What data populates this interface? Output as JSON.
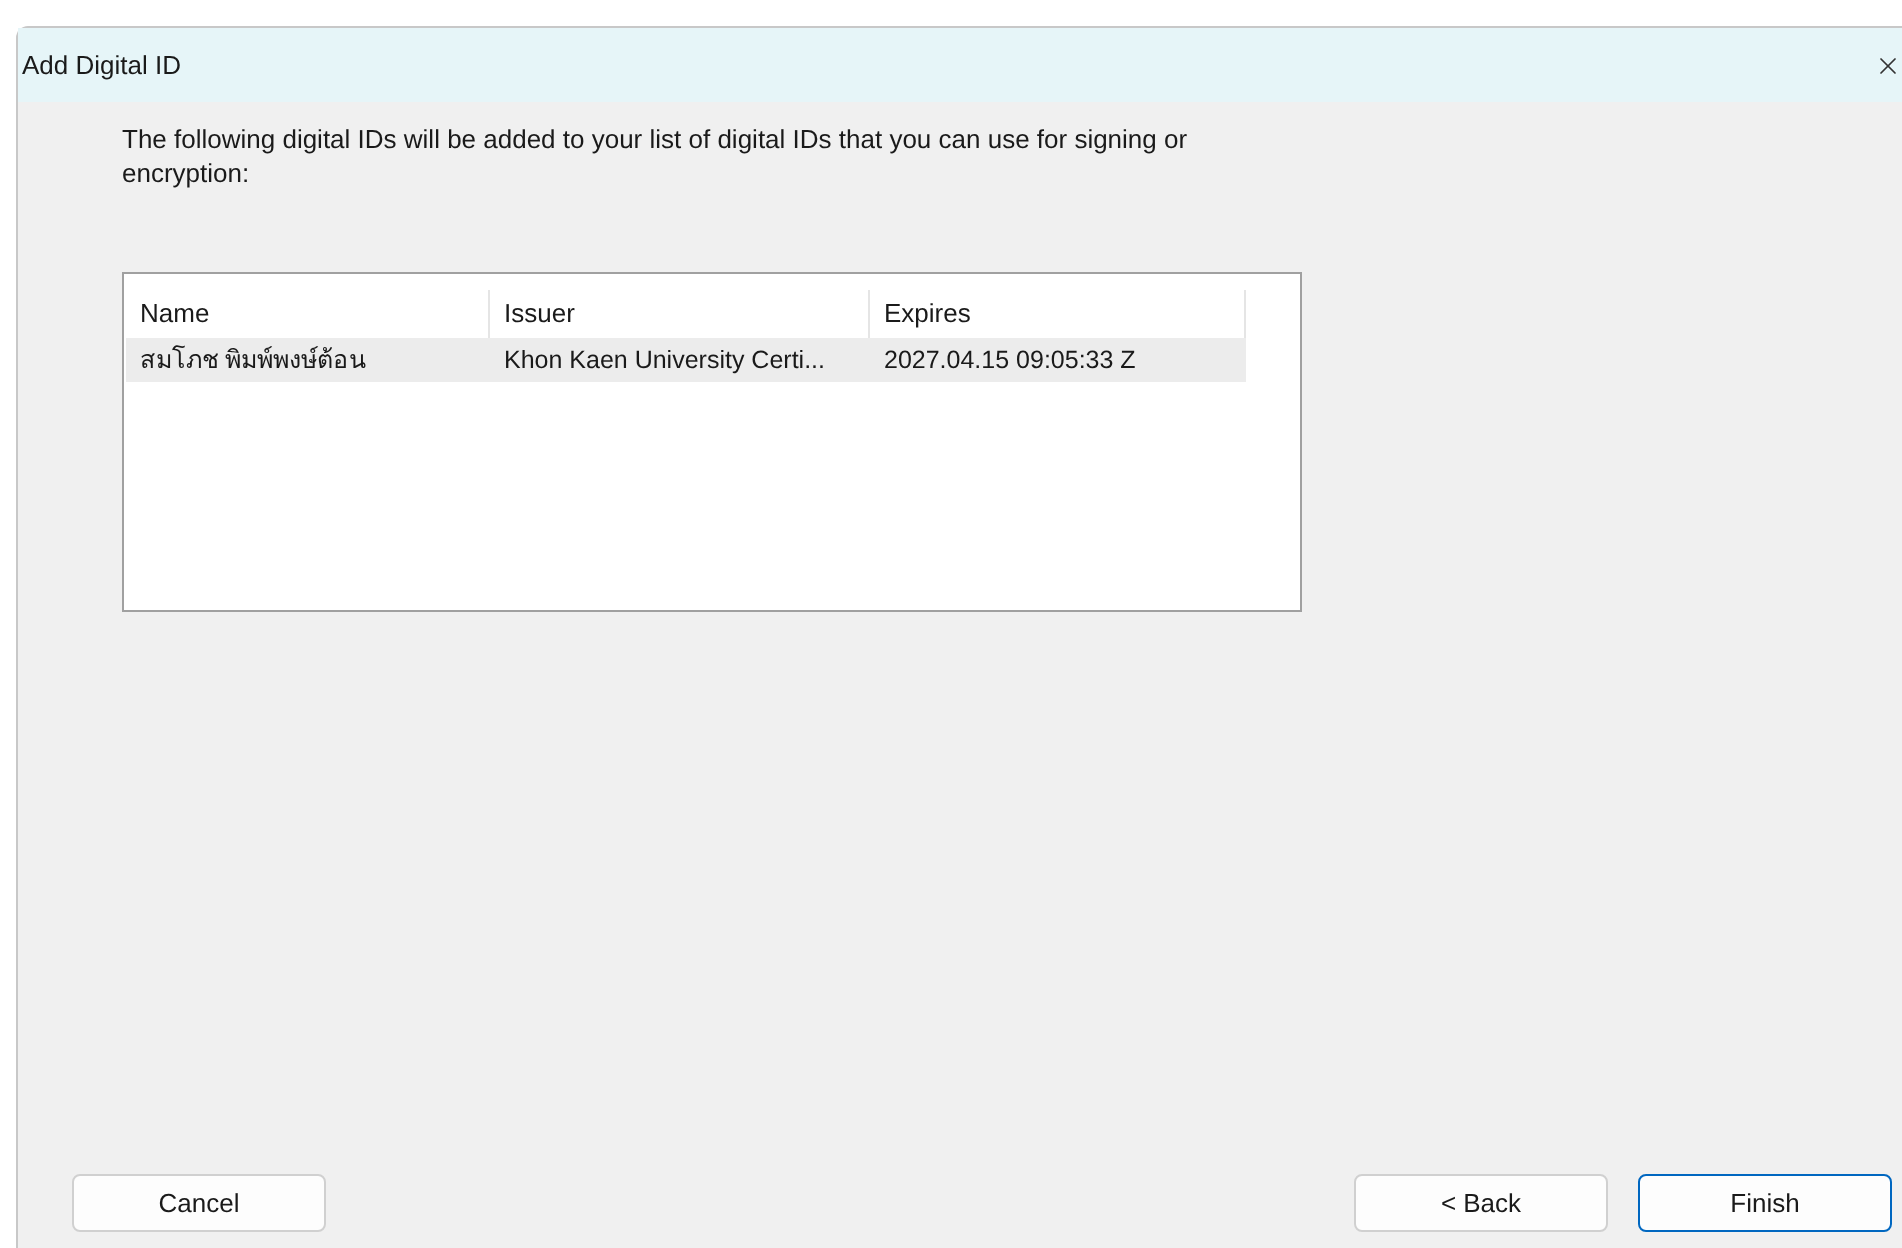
{
  "window": {
    "title": "Add Digital ID"
  },
  "message": "The following digital IDs will be added to your list of digital IDs that you can use for signing or encryption:",
  "table": {
    "columns": [
      "Name",
      "Issuer",
      "Expires"
    ],
    "rows": [
      {
        "cells": [
          "สมโภช พิมพ์พงษ์ต้อน",
          "Khon Kaen University Certi...",
          "2027.04.15 09:05:33 Z"
        ],
        "selected": true
      }
    ]
  },
  "buttons": [
    {
      "label": "Cancel",
      "kind": "normal"
    },
    {
      "label": "< Back",
      "kind": "normal"
    },
    {
      "label": "Finish",
      "kind": "default"
    }
  ]
}
